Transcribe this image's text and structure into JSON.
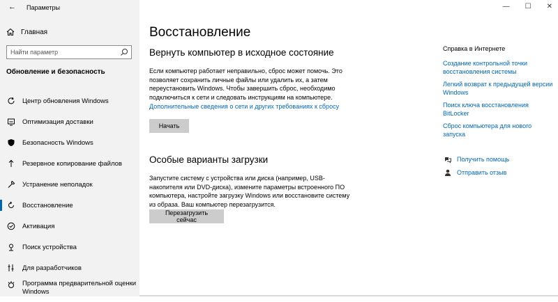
{
  "window": {
    "title": "Параметры",
    "controls": {
      "minimize": "—",
      "maximize": "☐",
      "close": "✕"
    }
  },
  "sidebar": {
    "home_label": "Главная",
    "search_placeholder": "Найти параметр",
    "section_title": "Обновление и безопасность",
    "items": [
      {
        "label": "Центр обновления Windows",
        "icon": "refresh-icon"
      },
      {
        "label": "Оптимизация доставки",
        "icon": "delivery-icon"
      },
      {
        "label": "Безопасность Windows",
        "icon": "shield-icon"
      },
      {
        "label": "Резервное копирование файлов",
        "icon": "backup-icon"
      },
      {
        "label": "Устранение неполадок",
        "icon": "wrench-icon"
      },
      {
        "label": "Восстановление",
        "icon": "recovery-icon",
        "selected": true
      },
      {
        "label": "Активация",
        "icon": "check-circle-icon"
      },
      {
        "label": "Поиск устройства",
        "icon": "find-device-icon"
      },
      {
        "label": "Для разработчиков",
        "icon": "developer-icon"
      },
      {
        "label": "Программа предварительной оценки Windows",
        "icon": "insider-icon"
      }
    ]
  },
  "main": {
    "page_title": "Восстановление",
    "reset": {
      "title": "Вернуть компьютер в исходное состояние",
      "description": "Если компьютер работает неправильно, сброс может помочь. Это позволяет сохранить личные файлы или удалить их, а затем переустановить Windows. Чтобы завершить сброс, необходимо подключиться к сети и следовать инструкциям на компьютере.",
      "link": "Дополнительные сведения о сети и других требованиях к сбросу",
      "button": "Начать"
    },
    "advanced": {
      "title": "Особые варианты загрузки",
      "description": "Запустите систему с устройства или диска (например, USB-накопителя или DVD-диска), измените параметры встроенного ПО компьютера, настройте загрузку Windows или восстановите систему из образа. Ваш компьютер перезагрузится.",
      "button": "Перезагрузить сейчас"
    }
  },
  "right": {
    "header": "Справка в Интернете",
    "links": [
      "Создание контрольной точки восстановления системы",
      "Легкий возврат к предыдущей версии Windows",
      "Поиск ключа восстановления BitLocker",
      "Сброс компьютера для нового запуска"
    ],
    "get_help": "Получить помощь",
    "feedback": "Отправить отзыв"
  },
  "colors": {
    "accent": "#0066b4",
    "sidebar_bg": "#f2f2f2",
    "button_bg": "#cccccc"
  }
}
